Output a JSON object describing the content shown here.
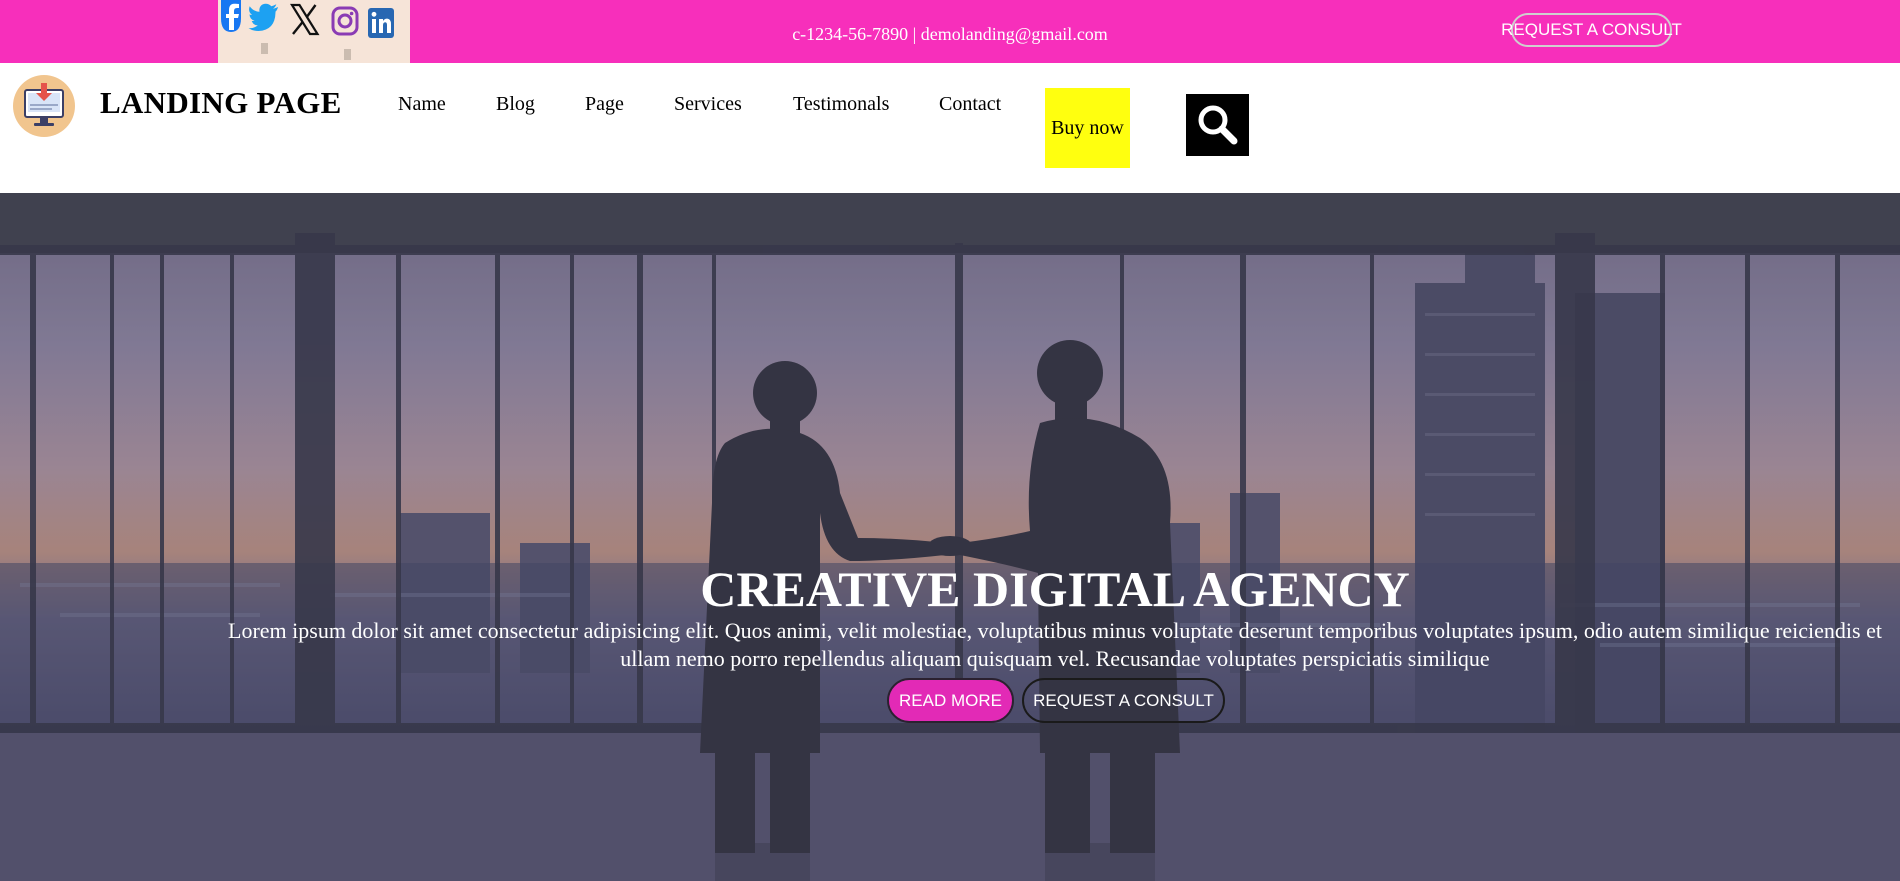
{
  "topbar": {
    "social_icons": [
      "facebook-icon",
      "twitter-icon",
      "x-icon",
      "instagram-icon",
      "linkedin-icon"
    ],
    "contact": "c-1234-56-7890 | demolanding@gmail.com",
    "consult_label": "REQUEST A CONSULT",
    "colors": {
      "bar": "#f72fbb",
      "social_bg": "#f6e4d8"
    }
  },
  "header": {
    "logo_icon": "download-monitor-icon",
    "brand": "LANDING PAGE",
    "nav": [
      "Name",
      "Blog",
      "Page",
      "Services",
      "Testimonals",
      "Contact"
    ],
    "buy_label": "Buy now",
    "search_icon": "search-icon",
    "colors": {
      "buy": "#ffff0f",
      "search": "#000000"
    }
  },
  "hero": {
    "image": "silhouettes-handshake-city-sunset-photo",
    "title": "CREATIVE DIGITAL AGENCY",
    "text": "Lorem ipsum dolor sit amet consectetur adipisicing elit. Quos animi, velit molestiae, voluptatibus minus voluptate deserunt temporibus voluptates ipsum, odio autem similique reiciendis et ullam nemo porro repellendus aliquam quisquam vel. Recusandae voluptates perspiciatis similique",
    "read_more": "READ MORE",
    "consult": "REQUEST A CONSULT",
    "colors": {
      "read_more": "#e22ab6"
    }
  }
}
